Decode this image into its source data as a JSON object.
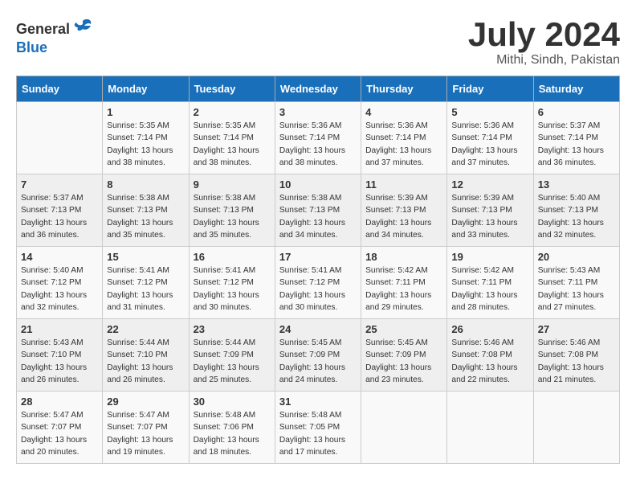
{
  "header": {
    "logo_general": "General",
    "logo_blue": "Blue",
    "month_year": "July 2024",
    "location": "Mithi, Sindh, Pakistan"
  },
  "weekdays": [
    "Sunday",
    "Monday",
    "Tuesday",
    "Wednesday",
    "Thursday",
    "Friday",
    "Saturday"
  ],
  "weeks": [
    [
      {
        "day": "",
        "sunrise": "",
        "sunset": "",
        "daylight": ""
      },
      {
        "day": "1",
        "sunrise": "Sunrise: 5:35 AM",
        "sunset": "Sunset: 7:14 PM",
        "daylight": "Daylight: 13 hours and 38 minutes."
      },
      {
        "day": "2",
        "sunrise": "Sunrise: 5:35 AM",
        "sunset": "Sunset: 7:14 PM",
        "daylight": "Daylight: 13 hours and 38 minutes."
      },
      {
        "day": "3",
        "sunrise": "Sunrise: 5:36 AM",
        "sunset": "Sunset: 7:14 PM",
        "daylight": "Daylight: 13 hours and 38 minutes."
      },
      {
        "day": "4",
        "sunrise": "Sunrise: 5:36 AM",
        "sunset": "Sunset: 7:14 PM",
        "daylight": "Daylight: 13 hours and 37 minutes."
      },
      {
        "day": "5",
        "sunrise": "Sunrise: 5:36 AM",
        "sunset": "Sunset: 7:14 PM",
        "daylight": "Daylight: 13 hours and 37 minutes."
      },
      {
        "day": "6",
        "sunrise": "Sunrise: 5:37 AM",
        "sunset": "Sunset: 7:14 PM",
        "daylight": "Daylight: 13 hours and 36 minutes."
      }
    ],
    [
      {
        "day": "7",
        "sunrise": "Sunrise: 5:37 AM",
        "sunset": "Sunset: 7:13 PM",
        "daylight": "Daylight: 13 hours and 36 minutes."
      },
      {
        "day": "8",
        "sunrise": "Sunrise: 5:38 AM",
        "sunset": "Sunset: 7:13 PM",
        "daylight": "Daylight: 13 hours and 35 minutes."
      },
      {
        "day": "9",
        "sunrise": "Sunrise: 5:38 AM",
        "sunset": "Sunset: 7:13 PM",
        "daylight": "Daylight: 13 hours and 35 minutes."
      },
      {
        "day": "10",
        "sunrise": "Sunrise: 5:38 AM",
        "sunset": "Sunset: 7:13 PM",
        "daylight": "Daylight: 13 hours and 34 minutes."
      },
      {
        "day": "11",
        "sunrise": "Sunrise: 5:39 AM",
        "sunset": "Sunset: 7:13 PM",
        "daylight": "Daylight: 13 hours and 34 minutes."
      },
      {
        "day": "12",
        "sunrise": "Sunrise: 5:39 AM",
        "sunset": "Sunset: 7:13 PM",
        "daylight": "Daylight: 13 hours and 33 minutes."
      },
      {
        "day": "13",
        "sunrise": "Sunrise: 5:40 AM",
        "sunset": "Sunset: 7:13 PM",
        "daylight": "Daylight: 13 hours and 32 minutes."
      }
    ],
    [
      {
        "day": "14",
        "sunrise": "Sunrise: 5:40 AM",
        "sunset": "Sunset: 7:12 PM",
        "daylight": "Daylight: 13 hours and 32 minutes."
      },
      {
        "day": "15",
        "sunrise": "Sunrise: 5:41 AM",
        "sunset": "Sunset: 7:12 PM",
        "daylight": "Daylight: 13 hours and 31 minutes."
      },
      {
        "day": "16",
        "sunrise": "Sunrise: 5:41 AM",
        "sunset": "Sunset: 7:12 PM",
        "daylight": "Daylight: 13 hours and 30 minutes."
      },
      {
        "day": "17",
        "sunrise": "Sunrise: 5:41 AM",
        "sunset": "Sunset: 7:12 PM",
        "daylight": "Daylight: 13 hours and 30 minutes."
      },
      {
        "day": "18",
        "sunrise": "Sunrise: 5:42 AM",
        "sunset": "Sunset: 7:11 PM",
        "daylight": "Daylight: 13 hours and 29 minutes."
      },
      {
        "day": "19",
        "sunrise": "Sunrise: 5:42 AM",
        "sunset": "Sunset: 7:11 PM",
        "daylight": "Daylight: 13 hours and 28 minutes."
      },
      {
        "day": "20",
        "sunrise": "Sunrise: 5:43 AM",
        "sunset": "Sunset: 7:11 PM",
        "daylight": "Daylight: 13 hours and 27 minutes."
      }
    ],
    [
      {
        "day": "21",
        "sunrise": "Sunrise: 5:43 AM",
        "sunset": "Sunset: 7:10 PM",
        "daylight": "Daylight: 13 hours and 26 minutes."
      },
      {
        "day": "22",
        "sunrise": "Sunrise: 5:44 AM",
        "sunset": "Sunset: 7:10 PM",
        "daylight": "Daylight: 13 hours and 26 minutes."
      },
      {
        "day": "23",
        "sunrise": "Sunrise: 5:44 AM",
        "sunset": "Sunset: 7:09 PM",
        "daylight": "Daylight: 13 hours and 25 minutes."
      },
      {
        "day": "24",
        "sunrise": "Sunrise: 5:45 AM",
        "sunset": "Sunset: 7:09 PM",
        "daylight": "Daylight: 13 hours and 24 minutes."
      },
      {
        "day": "25",
        "sunrise": "Sunrise: 5:45 AM",
        "sunset": "Sunset: 7:09 PM",
        "daylight": "Daylight: 13 hours and 23 minutes."
      },
      {
        "day": "26",
        "sunrise": "Sunrise: 5:46 AM",
        "sunset": "Sunset: 7:08 PM",
        "daylight": "Daylight: 13 hours and 22 minutes."
      },
      {
        "day": "27",
        "sunrise": "Sunrise: 5:46 AM",
        "sunset": "Sunset: 7:08 PM",
        "daylight": "Daylight: 13 hours and 21 minutes."
      }
    ],
    [
      {
        "day": "28",
        "sunrise": "Sunrise: 5:47 AM",
        "sunset": "Sunset: 7:07 PM",
        "daylight": "Daylight: 13 hours and 20 minutes."
      },
      {
        "day": "29",
        "sunrise": "Sunrise: 5:47 AM",
        "sunset": "Sunset: 7:07 PM",
        "daylight": "Daylight: 13 hours and 19 minutes."
      },
      {
        "day": "30",
        "sunrise": "Sunrise: 5:48 AM",
        "sunset": "Sunset: 7:06 PM",
        "daylight": "Daylight: 13 hours and 18 minutes."
      },
      {
        "day": "31",
        "sunrise": "Sunrise: 5:48 AM",
        "sunset": "Sunset: 7:05 PM",
        "daylight": "Daylight: 13 hours and 17 minutes."
      },
      {
        "day": "",
        "sunrise": "",
        "sunset": "",
        "daylight": ""
      },
      {
        "day": "",
        "sunrise": "",
        "sunset": "",
        "daylight": ""
      },
      {
        "day": "",
        "sunrise": "",
        "sunset": "",
        "daylight": ""
      }
    ]
  ]
}
